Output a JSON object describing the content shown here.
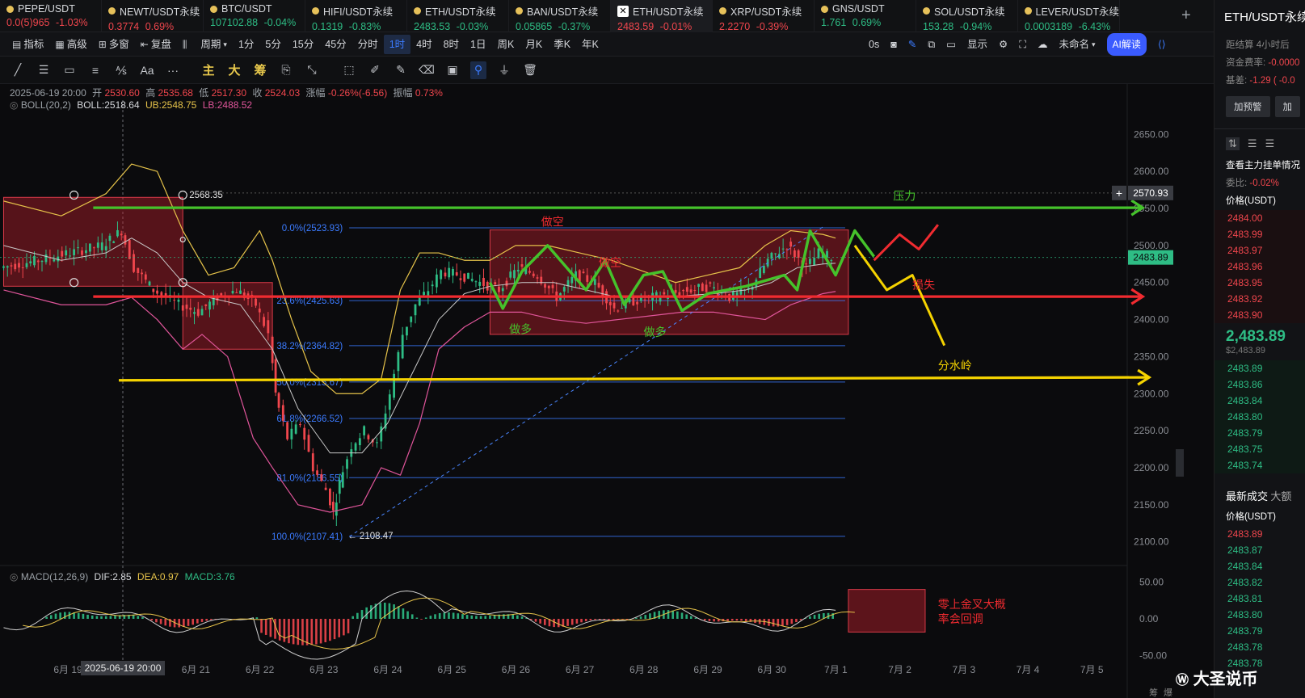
{
  "tickers": [
    {
      "name": "PEPE/USDT",
      "price": "0.0(5)965",
      "change": "-1.03%",
      "dir": "down",
      "icon": "coin-icon"
    },
    {
      "name": "NEWT/USDT永续",
      "price": "0.3774",
      "change": "0.69%",
      "dir": "down",
      "icon": "coin-icon"
    },
    {
      "name": "BTC/USDT",
      "price": "107102.88",
      "change": "-0.04%",
      "dir": "up",
      "icon": "coin-icon"
    },
    {
      "name": "HIFI/USDT永续",
      "price": "0.1319",
      "change": "-0.83%",
      "dir": "up",
      "icon": "coin-icon"
    },
    {
      "name": "ETH/USDT永续",
      "price": "2483.53",
      "change": "-0.03%",
      "dir": "up",
      "icon": "coin-icon"
    },
    {
      "name": "BAN/USDT永续",
      "price": "0.05865",
      "change": "-0.37%",
      "dir": "up",
      "icon": "coin-icon"
    },
    {
      "name": "ETH/USDT永续",
      "price": "2483.59",
      "change": "-0.01%",
      "dir": "down",
      "icon": "exchange-x-icon",
      "active": true
    },
    {
      "name": "XRP/USDT永续",
      "price": "2.2270",
      "change": "-0.39%",
      "dir": "down",
      "icon": "coin-icon"
    },
    {
      "name": "GNS/USDT",
      "price": "1.761",
      "change": "0.69%",
      "dir": "up",
      "icon": "coin-icon"
    },
    {
      "name": "SOL/USDT永续",
      "price": "153.28",
      "change": "-0.94%",
      "dir": "up",
      "icon": "coin-icon"
    },
    {
      "name": "LEVER/USDT永续",
      "price": "0.0003189",
      "change": "-6.43%",
      "dir": "up",
      "icon": "coin-icon"
    }
  ],
  "toolbar": {
    "items": [
      {
        "icon": "indicator-icon",
        "label": "指标"
      },
      {
        "icon": "advanced-icon",
        "label": "高级"
      },
      {
        "icon": "multi-window-icon",
        "label": "多窗"
      },
      {
        "icon": "replay-icon",
        "label": "复盘"
      },
      {
        "icon": "bar-type-icon",
        "label": ""
      },
      {
        "icon": "",
        "label": "周期"
      }
    ],
    "periods": [
      "1分",
      "5分",
      "15分",
      "45分",
      "分时",
      "1时",
      "4时",
      "8时",
      "1日",
      "周K",
      "月K",
      "季K",
      "年K"
    ],
    "selected_period": "1时",
    "right": {
      "countdown": "0s",
      "display_label": "显示",
      "layout_label": "未命名",
      "ai_label": "AI解读"
    }
  },
  "drawing_tools": [
    "trend-line-icon",
    "horizontal-lines-icon",
    "rectangle-icon",
    "parallel-lines-icon",
    "fib-icon",
    "text-tool-icon",
    "more-icon",
    "主",
    "大",
    "筹",
    "chip-icon",
    "measure-icon",
    "cursor-icon",
    "pen-icon",
    "brush-icon",
    "clear-icon",
    "save-icon",
    "magnet-icon",
    "filter-icon",
    "trash-icon"
  ],
  "ohlc": {
    "date": "2025-06-19 20:00",
    "open_label": "开",
    "open": "2530.60",
    "high_label": "高",
    "high": "2535.68",
    "low_label": "低",
    "low": "2517.30",
    "close_label": "收",
    "close": "2524.03",
    "change_label": "涨幅",
    "change": "-0.26%(-6.56)",
    "amp_label": "振幅",
    "amp": "0.73%"
  },
  "boll": {
    "label": "BOLL(20,2)",
    "boll": "BOLL:2518.64",
    "ub": "UB:2548.75",
    "lb": "LB:2488.52"
  },
  "macd": {
    "label": "MACD(12,26,9)",
    "dif": "DIF:2.85",
    "dea": "DEA:0.97",
    "macd": "MACD:3.76"
  },
  "colors": {
    "up": "#2ebd85",
    "down": "#f0464d",
    "green_line": "#45c22b",
    "red_line": "#f02b30",
    "yellow_line": "#f5d300",
    "fib": "#3b7bff",
    "boll_upper": "#e6c34a",
    "boll_lower": "#e0559a",
    "boll_mid": "#c9c9c9"
  },
  "chart_data": {
    "type": "candlestick",
    "price_axis": {
      "min": 2080,
      "max": 2670,
      "ticks": [
        2650.0,
        2600.0,
        2550.0,
        2500.0,
        2450.0,
        2400.0,
        2350.0,
        2300.0,
        2250.0,
        2200.0,
        2150.0,
        2100.0
      ],
      "tick_labels": [
        "2650.00",
        "2600.00",
        "2550.00",
        "2500.00",
        "2450.00",
        "2400.00",
        "2350.00",
        "2300.00",
        "2250.00",
        "2200.00",
        "2150.00",
        "2100.00"
      ]
    },
    "macd_axis": {
      "ticks": [
        50.0,
        0.0,
        -50.0
      ],
      "tick_labels": [
        "50.00",
        "0.00",
        "-50.00"
      ],
      "min": -55,
      "max": 55
    },
    "x_labels": [
      "6月 19",
      "6月 21",
      "6月 22",
      "6月 23",
      "6月 24",
      "6月 25",
      "6月 26",
      "6月 27",
      "6月 28",
      "6月 29",
      "6月 30",
      "7月 1",
      "7月 2",
      "7月 3",
      "7月 4",
      "7月 5"
    ],
    "x_days": [
      19,
      21,
      22,
      23,
      24,
      25,
      26,
      27,
      28,
      29,
      30,
      31,
      32,
      33,
      34,
      35
    ],
    "crosshair_label": "2025-06-19 20:00",
    "price_marker": {
      "value": 2483.89,
      "label": "2483.89"
    },
    "hover_marker": {
      "value": 2570.93,
      "label": "2570.93"
    },
    "high_label": {
      "value": 2568.35,
      "label": "2568.35"
    },
    "low_label": {
      "value": 2108.47,
      "label": "← 2108.47"
    },
    "fib_levels": [
      {
        "label": "0.0%(2523.93)",
        "value": 2523.93
      },
      {
        "label": "23.6%(2425.63)",
        "value": 2425.63
      },
      {
        "label": "38.2%(2364.82)",
        "value": 2364.82
      },
      {
        "label": "50.0%(2315.67)",
        "value": 2315.67
      },
      {
        "label": "61.8%(2266.52)",
        "value": 2266.52
      },
      {
        "label": "81.0%(2186.55)",
        "value": 2186.55
      },
      {
        "label": "100.0%(2107.41)",
        "value": 2107.41
      }
    ],
    "price_path": [
      [
        18.4,
        2470
      ],
      [
        19.0,
        2480
      ],
      [
        19.5,
        2490
      ],
      [
        20.0,
        2500
      ],
      [
        20.3,
        2520
      ],
      [
        20.5,
        2470
      ],
      [
        20.8,
        2440
      ],
      [
        21.2,
        2420
      ],
      [
        21.5,
        2410
      ],
      [
        21.8,
        2430
      ],
      [
        22.1,
        2440
      ],
      [
        22.4,
        2420
      ],
      [
        22.6,
        2380
      ],
      [
        22.7,
        2300
      ],
      [
        22.9,
        2240
      ],
      [
        23.1,
        2260
      ],
      [
        23.3,
        2200
      ],
      [
        23.5,
        2170
      ],
      [
        23.6,
        2140
      ],
      [
        23.7,
        2180
      ],
      [
        23.9,
        2230
      ],
      [
        24.1,
        2250
      ],
      [
        24.3,
        2230
      ],
      [
        24.5,
        2300
      ],
      [
        24.7,
        2380
      ],
      [
        24.9,
        2420
      ],
      [
        25.1,
        2440
      ],
      [
        25.3,
        2465
      ],
      [
        25.6,
        2460
      ],
      [
        25.9,
        2450
      ],
      [
        26.2,
        2440
      ],
      [
        26.5,
        2470
      ],
      [
        26.8,
        2460
      ],
      [
        27.1,
        2430
      ],
      [
        27.4,
        2460
      ],
      [
        27.7,
        2450
      ],
      [
        28.0,
        2415
      ],
      [
        28.3,
        2425
      ],
      [
        28.6,
        2430
      ],
      [
        28.9,
        2435
      ],
      [
        29.2,
        2440
      ],
      [
        29.5,
        2445
      ],
      [
        29.8,
        2430
      ],
      [
        30.1,
        2440
      ],
      [
        30.4,
        2480
      ],
      [
        30.7,
        2500
      ],
      [
        31.0,
        2470
      ],
      [
        31.2,
        2490
      ],
      [
        31.4,
        2484
      ]
    ],
    "boll_upper_path": [
      [
        18.4,
        2560
      ],
      [
        19.3,
        2540
      ],
      [
        20.0,
        2570
      ],
      [
        20.4,
        2610
      ],
      [
        20.8,
        2600
      ],
      [
        21.2,
        2520
      ],
      [
        21.6,
        2460
      ],
      [
        22.0,
        2470
      ],
      [
        22.4,
        2520
      ],
      [
        22.6,
        2480
      ],
      [
        22.9,
        2400
      ],
      [
        23.2,
        2330
      ],
      [
        23.6,
        2300
      ],
      [
        24.0,
        2300
      ],
      [
        24.3,
        2320
      ],
      [
        24.6,
        2440
      ],
      [
        24.9,
        2490
      ],
      [
        25.2,
        2490
      ],
      [
        25.6,
        2480
      ],
      [
        26.0,
        2480
      ],
      [
        26.4,
        2500
      ],
      [
        26.9,
        2500
      ],
      [
        27.4,
        2490
      ],
      [
        27.9,
        2480
      ],
      [
        28.4,
        2465
      ],
      [
        28.9,
        2450
      ],
      [
        29.4,
        2460
      ],
      [
        29.9,
        2470
      ],
      [
        30.3,
        2500
      ],
      [
        30.7,
        2520
      ],
      [
        31.2,
        2515
      ],
      [
        31.4,
        2510
      ]
    ],
    "boll_lower_path": [
      [
        18.4,
        2440
      ],
      [
        19.3,
        2420
      ],
      [
        20.0,
        2420
      ],
      [
        20.4,
        2430
      ],
      [
        20.8,
        2400
      ],
      [
        21.2,
        2360
      ],
      [
        21.5,
        2380
      ],
      [
        21.9,
        2350
      ],
      [
        22.3,
        2240
      ],
      [
        22.6,
        2200
      ],
      [
        23.0,
        2150
      ],
      [
        23.5,
        2140
      ],
      [
        24.0,
        2150
      ],
      [
        24.3,
        2200
      ],
      [
        24.6,
        2190
      ],
      [
        24.9,
        2260
      ],
      [
        25.2,
        2360
      ],
      [
        25.6,
        2390
      ],
      [
        26.0,
        2410
      ],
      [
        26.5,
        2410
      ],
      [
        27.0,
        2400
      ],
      [
        27.5,
        2395
      ],
      [
        28.0,
        2400
      ],
      [
        28.5,
        2405
      ],
      [
        29.0,
        2410
      ],
      [
        29.5,
        2410
      ],
      [
        29.9,
        2405
      ],
      [
        30.3,
        2400
      ],
      [
        30.7,
        2420
      ],
      [
        31.2,
        2435
      ],
      [
        31.4,
        2438
      ]
    ],
    "boll_mid_path": [
      [
        18.4,
        2500
      ],
      [
        19.3,
        2480
      ],
      [
        20.0,
        2490
      ],
      [
        20.4,
        2510
      ],
      [
        20.8,
        2490
      ],
      [
        21.2,
        2450
      ],
      [
        21.6,
        2430
      ],
      [
        22.1,
        2420
      ],
      [
        22.6,
        2360
      ],
      [
        23.0,
        2280
      ],
      [
        23.5,
        2220
      ],
      [
        24.0,
        2220
      ],
      [
        24.4,
        2260
      ],
      [
        24.8,
        2330
      ],
      [
        25.2,
        2400
      ],
      [
        25.6,
        2435
      ],
      [
        26.0,
        2445
      ],
      [
        26.5,
        2450
      ],
      [
        27.0,
        2450
      ],
      [
        27.5,
        2440
      ],
      [
        28.0,
        2430
      ],
      [
        28.5,
        2430
      ],
      [
        29.0,
        2432
      ],
      [
        29.5,
        2435
      ],
      [
        30.0,
        2440
      ],
      [
        30.4,
        2450
      ],
      [
        30.8,
        2470
      ],
      [
        31.2,
        2475
      ],
      [
        31.4,
        2476
      ]
    ],
    "annotations": {
      "labels": [
        {
          "text": "压力",
          "color": "#45c22b",
          "day": 32.3,
          "value": 2567
        },
        {
          "text": "损失",
          "color": "#f02b30",
          "day": 32.6,
          "value": 2447
        },
        {
          "text": "分水岭",
          "color": "#f5d300",
          "day": 33.0,
          "value": 2338
        },
        {
          "text": "做空",
          "color": "#f02b30",
          "day": 26.8,
          "value": 2532
        },
        {
          "text": "做空",
          "color": "#f02b30",
          "day": 27.7,
          "value": 2477
        },
        {
          "text": "做多",
          "color": "#45c22b",
          "day": 26.3,
          "value": 2387
        },
        {
          "text": "做多",
          "color": "#45c22b",
          "day": 28.4,
          "value": 2383
        },
        {
          "text": "零上金叉大概",
          "color": "#f02b30",
          "day": 33.0,
          "macd": 20
        },
        {
          "text": "率会回调",
          "color": "#f02b30",
          "day": 33.0,
          "macd": 0
        }
      ],
      "green_line": {
        "from": [
          19.8,
          2551
        ],
        "to": [
          36.2,
          2551
        ]
      },
      "red_line": {
        "from": [
          19.8,
          2431
        ],
        "to": [
          36.2,
          2431
        ]
      },
      "yellow_line": {
        "from": [
          20.2,
          2318
        ],
        "to": [
          36.3,
          2322
        ]
      },
      "green_zigzag": [
        [
          26.0,
          2450
        ],
        [
          26.2,
          2415
        ],
        [
          26.5,
          2465
        ],
        [
          26.9,
          2500
        ],
        [
          27.1,
          2480
        ],
        [
          27.5,
          2440
        ],
        [
          27.8,
          2480
        ],
        [
          28.1,
          2420
        ],
        [
          28.4,
          2460
        ],
        [
          28.7,
          2465
        ],
        [
          29.0,
          2412
        ],
        [
          29.4,
          2435
        ],
        [
          30.0,
          2445
        ],
        [
          30.6,
          2460
        ],
        [
          30.8,
          2440
        ],
        [
          31.0,
          2520
        ],
        [
          31.2,
          2490
        ],
        [
          31.4,
          2460
        ],
        [
          31.7,
          2520
        ],
        [
          32.0,
          2485
        ]
      ],
      "red_forecast": [
        [
          32.0,
          2480
        ],
        [
          32.4,
          2515
        ],
        [
          32.7,
          2495
        ],
        [
          33.0,
          2528
        ]
      ],
      "yellow_forecast": [
        [
          31.7,
          2500
        ],
        [
          32.2,
          2440
        ],
        [
          32.6,
          2460
        ],
        [
          33.1,
          2365
        ]
      ],
      "blue_dashed": {
        "from": [
          23.8,
          2107
        ],
        "to": [
          31.2,
          2525
        ]
      },
      "rectangles": [
        {
          "from": [
            18.4,
            2565
          ],
          "to": [
            21.2,
            2445
          ]
        },
        {
          "from": [
            21.2,
            2450
          ],
          "to": [
            22.6,
            2360
          ]
        },
        {
          "from": [
            26.0,
            2521
          ],
          "to": [
            31.6,
            2380
          ]
        }
      ],
      "macd_rect": {
        "from": [
          31.6,
          40
        ],
        "to": [
          32.8,
          -18
        ]
      }
    }
  },
  "right_panel": {
    "title": "ETH/USDT永续",
    "rows": [
      {
        "label": "距结算",
        "value": "4小时后"
      },
      {
        "label": "资金费率:",
        "value": "-0.0000"
      },
      {
        "label": "基差:",
        "value": "-1.29 ( -0.0"
      }
    ],
    "buttons": [
      "加预警",
      "加"
    ],
    "orderbook_title": "查看主力挂单情况",
    "ratio_label": "委比:",
    "ratio_value": "-0.02%",
    "price_header": "价格(USDT)",
    "asks": [
      "2484.00",
      "2483.99",
      "2483.97",
      "2483.96",
      "2483.95",
      "2483.92",
      "2483.90"
    ],
    "last_price": "2,483.89",
    "last_price_sub": "$2,483.89",
    "bids": [
      "2483.89",
      "2483.86",
      "2483.84",
      "2483.80",
      "2483.79",
      "2483.75",
      "2483.74"
    ],
    "trades_title": "最新成交",
    "trades_tab2": "大额",
    "trades_header": "价格(USDT)",
    "trades": [
      {
        "p": "2483.89",
        "d": "down"
      },
      {
        "p": "2483.87",
        "d": "up"
      },
      {
        "p": "2483.84",
        "d": "up"
      },
      {
        "p": "2483.82",
        "d": "up"
      },
      {
        "p": "2483.81",
        "d": "up"
      },
      {
        "p": "2483.80",
        "d": "up"
      },
      {
        "p": "2483.79",
        "d": "up"
      },
      {
        "p": "2483.78",
        "d": "up"
      },
      {
        "p": "2483.78",
        "d": "up"
      }
    ]
  },
  "watermark": "大圣说币",
  "footer_small": [
    "筹",
    "爆"
  ]
}
